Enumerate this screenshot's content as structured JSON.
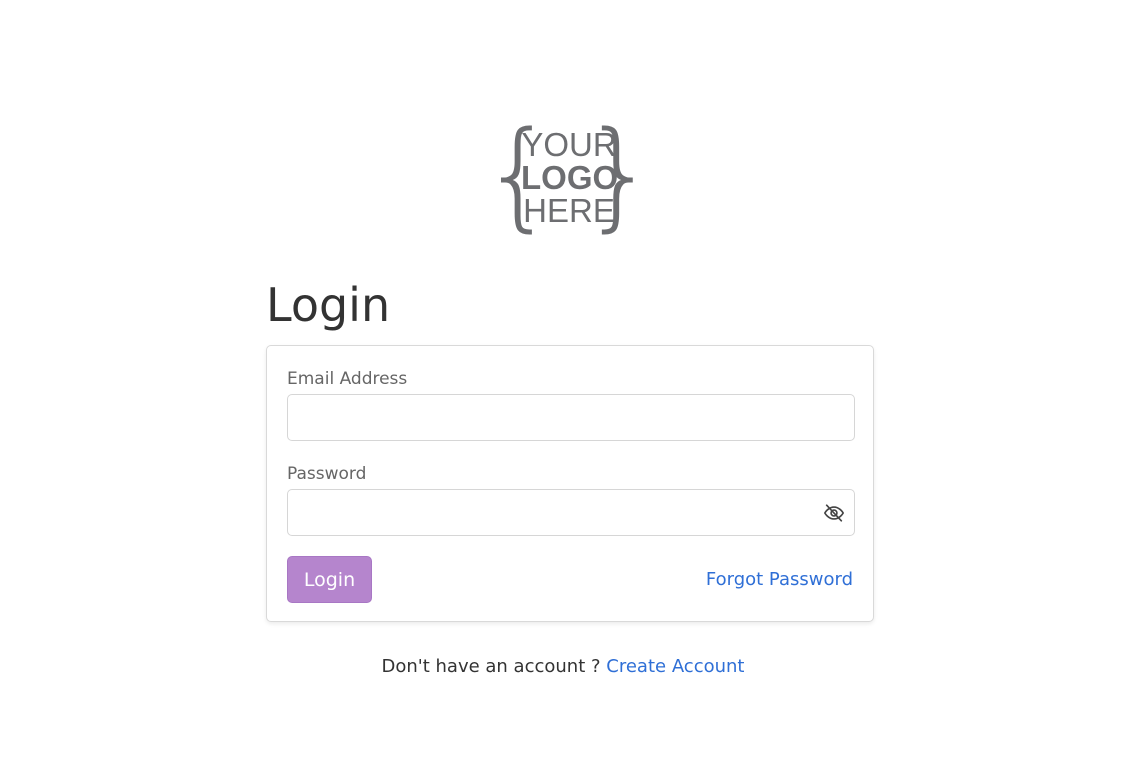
{
  "logo": {
    "line1": "YOUR",
    "line2": "LOGO",
    "line3": "HERE",
    "color": "#6d6e71"
  },
  "heading": "Login",
  "form": {
    "email_label": "Email Address",
    "email_value": "",
    "email_placeholder": "",
    "password_label": "Password",
    "password_value": "",
    "password_placeholder": "",
    "toggle_icon": "eye-slash-icon",
    "login_label": "Login",
    "forgot_label": "Forgot Password"
  },
  "footer": {
    "prompt": "Don't have an account ?",
    "create_label": "Create Account"
  },
  "colors": {
    "accent": "#b585cd",
    "link": "#2f6fd6",
    "text": "#333333"
  }
}
